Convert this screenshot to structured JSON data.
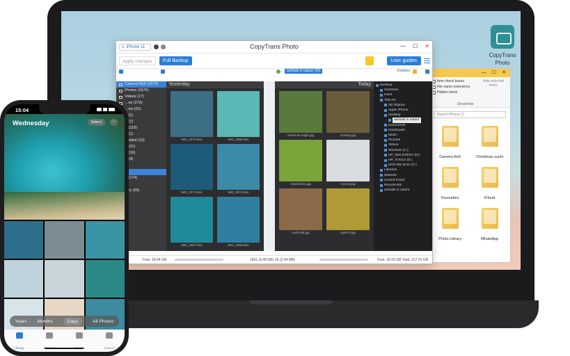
{
  "desktop": {
    "icon_label_line1": "CopyTrans",
    "icon_label_line2": "Photo"
  },
  "explorer": {
    "ribbon": {
      "item_check_boxes": "Item check boxes",
      "file_name_extensions": "File name extensions",
      "hidden_items": "Hidden items",
      "hide_selected": "Hide selected items",
      "options": "Options",
      "group": "Show/hide"
    },
    "search_placeholder": "Search iPhone 11",
    "folders": [
      "Camera Roll",
      "Christmas sushi",
      "Favourites",
      "iCloud",
      "Photo Library",
      "WhatsApp"
    ]
  },
  "app": {
    "title": "CopyTrans Photo",
    "device": "1. iPhone 11",
    "apply_changes": "Apply changes",
    "full_backup": "Full Backup",
    "user_guides": "User guides",
    "pc_folder_chip": "animals in nature (16)",
    "explorer_label": "Explorer",
    "iphone_albums": [
      {
        "label": "Camera Roll (1674)",
        "active": true
      },
      {
        "label": "Photos (1674)",
        "active": false
      },
      {
        "label": "Videos (17)",
        "active": false
      },
      {
        "label": "…es (279)",
        "active": false
      },
      {
        "label": "…ies (61)",
        "active": false
      },
      {
        "label": "…(1)",
        "active": false
      },
      {
        "label": "…(1)",
        "active": false
      },
      {
        "label": "…(118)",
        "active": false
      },
      {
        "label": "…(1)",
        "active": false
      },
      {
        "label": "…leted (10)",
        "active": false
      },
      {
        "label": "…(31)",
        "active": false
      },
      {
        "label": "…(16)",
        "active": false
      },
      {
        "label": "…(4)",
        "active": false
      },
      {
        "label": "",
        "active": false
      },
      {
        "label": "",
        "active": true
      },
      {
        "label": "…(174)",
        "active": false
      },
      {
        "label": "",
        "active": false
      },
      {
        "label": "…ry (55)",
        "active": false
      }
    ],
    "iphone_header": "Yesterday",
    "iphone_photos": [
      {
        "name": "IMG_3370.heic",
        "color": "#3d6f86"
      },
      {
        "name": "IMG_3369.heic",
        "color": "#5bb8b4"
      },
      {
        "name": "IMG_3371.heic",
        "color": "#1d5b7a"
      },
      {
        "name": "IMG_3372.heic",
        "color": "#3b8aa8"
      },
      {
        "name": "IMG_3367.heic",
        "color": "#1e8a9a"
      },
      {
        "name": "IMG_3368.heic",
        "color": "#2f7fa0"
      }
    ],
    "pc_header": "Today",
    "pc_photos": [
      {
        "name": "american eagle.jpg",
        "color": "#5a7a3c"
      },
      {
        "name": "monkey.jpg",
        "color": "#6a5d3b"
      },
      {
        "name": "chameleon.jpg",
        "color": "#7aa43a"
      },
      {
        "name": "moose.jpg",
        "color": "#d9dcdf"
      },
      {
        "name": "kudu bull.jpg",
        "color": "#8a6a48"
      },
      {
        "name": "squirrel.jpg",
        "color": "#b09a36"
      }
    ],
    "tree": [
      {
        "label": "Desktop",
        "indent": 0,
        "sel": false
      },
      {
        "label": "OneDrive",
        "indent": 1,
        "sel": false
      },
      {
        "label": "Hans",
        "indent": 1,
        "sel": false
      },
      {
        "label": "This PC",
        "indent": 1,
        "sel": false
      },
      {
        "label": "3D Objects",
        "indent": 2,
        "sel": false
      },
      {
        "label": "Apple iPhone",
        "indent": 2,
        "sel": false
      },
      {
        "label": "Desktop",
        "indent": 2,
        "sel": false
      },
      {
        "label": "animals in nature",
        "indent": 3,
        "sel": true
      },
      {
        "label": "Documents",
        "indent": 2,
        "sel": false
      },
      {
        "label": "Downloads",
        "indent": 2,
        "sel": false
      },
      {
        "label": "Music",
        "indent": 2,
        "sel": false
      },
      {
        "label": "Pictures",
        "indent": 2,
        "sel": false
      },
      {
        "label": "Videos",
        "indent": 2,
        "sel": false
      },
      {
        "label": "Windows (C:)",
        "indent": 2,
        "sel": false
      },
      {
        "label": "HP_RECOVERY (D:)",
        "indent": 2,
        "sel": false
      },
      {
        "label": "HP_TOOLS (E:)",
        "indent": 2,
        "sel": false
      },
      {
        "label": "DVD RW Drive (F:)",
        "indent": 2,
        "sel": false
      },
      {
        "label": "Libraries",
        "indent": 1,
        "sel": false
      },
      {
        "label": "Network",
        "indent": 1,
        "sel": false
      },
      {
        "label": "Control Panel",
        "indent": 1,
        "sel": false
      },
      {
        "label": "Recycle Bin",
        "indent": 1,
        "sel": false
      },
      {
        "label": "animals in nature",
        "indent": 1,
        "sel": false
      }
    ],
    "status": {
      "left": "Free: 18.64 GB",
      "mid": "1691 (3.49 GB)",
      "pc": "16 (2.34 MB)",
      "right": "Free: 26.03 GB Total: 217.01 GB"
    }
  },
  "phone": {
    "time": "15:04",
    "title": "Wednesday",
    "select": "Select",
    "more": "···",
    "segments": [
      {
        "label": "Years",
        "active": false
      },
      {
        "label": "Months",
        "active": false
      },
      {
        "label": "Days",
        "active": true
      },
      {
        "label": "All Photos",
        "active": false
      }
    ],
    "grid_colors": [
      "#2d6f8a",
      "#7d8c92",
      "#3a94a6",
      "#bfd3dc",
      "#c9d4da",
      "#2b8a86",
      "#d7e4ea",
      "#e6d8c4",
      "#3c8ba0"
    ],
    "tabs": [
      {
        "label": "Library",
        "active": true
      },
      {
        "label": "For You",
        "active": false
      },
      {
        "label": "Albums",
        "active": false
      },
      {
        "label": "Search",
        "active": false
      }
    ]
  }
}
